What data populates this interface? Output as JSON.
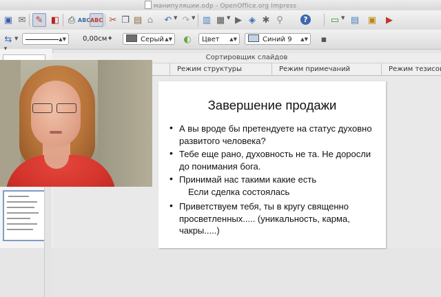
{
  "window": {
    "title": "манипуляции.odp - OpenOffice.org Impress"
  },
  "toolbar1": {
    "icons": [
      "save-icon",
      "mail-icon",
      "edit-icon",
      "pdf-icon",
      "print-icon",
      "print-preview-icon",
      "spellcheck-icon",
      "autospell-icon",
      "cut-icon",
      "copy-icon",
      "paste-icon",
      "format-paintbrush-icon",
      "undo-icon",
      "redo-icon",
      "chart-icon",
      "table-icon",
      "movie-icon",
      "draw-functions-icon",
      "help-icon",
      "slide-icon",
      "slide-layout-icon",
      "slide-design-icon",
      "presentation-icon"
    ]
  },
  "toolbar2": {
    "line_width": "0,00см",
    "line_color_label": "Серый",
    "line_color_hex": "#6d6d6d",
    "area_style": "Цвет",
    "area_color_label": "Синий 9",
    "area_color_hex": "#bfd3ea"
  },
  "slide_sorter": {
    "label": "Сортировщик слайдов"
  },
  "view_tabs": [
    {
      "label": "Режим структуры"
    },
    {
      "label": "Режим примечаний"
    },
    {
      "label": "Режим тезисов"
    }
  ],
  "slide": {
    "title": "Завершение продажи",
    "bullets": [
      "А вы вроде бы претендуете на статус духовно развитого человека?",
      "Тебе еще рано, духовность не та. Не доросли до понимания бога.",
      "Принимай нас такими какие есть"
    ],
    "sub_item": "Если сделка состоялась",
    "last_bullet": "Приветствуем тебя, ты в кругу священно просветленных..... (уникальность, карма, чакры.....)"
  }
}
